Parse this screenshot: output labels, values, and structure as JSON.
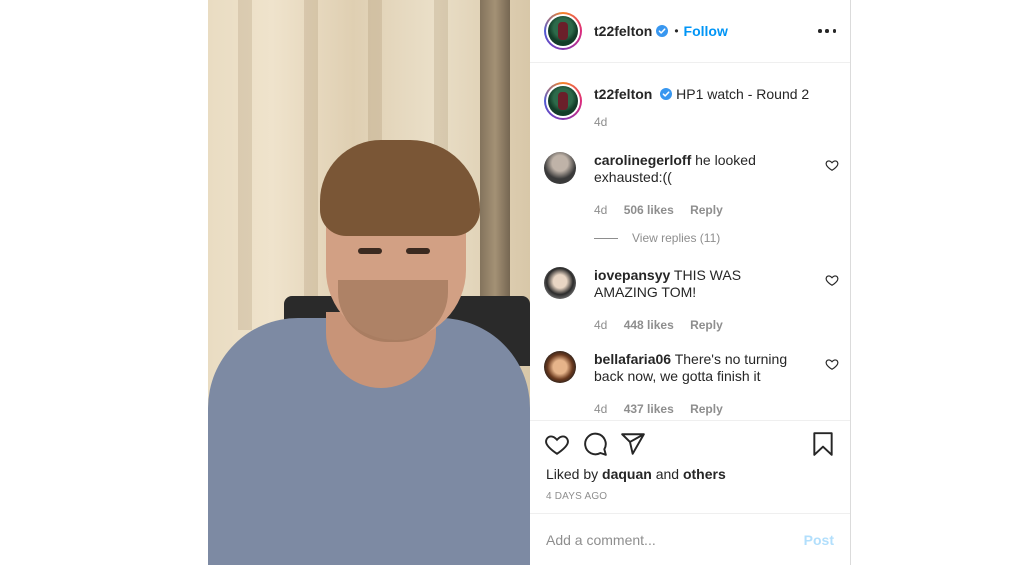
{
  "post": {
    "author": "t22felton",
    "follow_label": "Follow",
    "dot": "•",
    "caption": "HP1 watch - Round 2",
    "caption_time": "4d"
  },
  "comments": [
    {
      "user": "carolinegerloff",
      "text": "he looked exhausted:((",
      "time": "4d",
      "likes": "506 likes",
      "reply": "Reply",
      "avatar_color": "#3a3a3a"
    },
    {
      "user": "iovepansyy",
      "text": "THIS WAS AMAZING TOM!",
      "time": "4d",
      "likes": "448 likes",
      "reply": "Reply",
      "avatar_color": "#4a4a4a"
    },
    {
      "user": "bellafaria06",
      "text": "There's no turning back now, we gotta finish it",
      "time": "4d",
      "likes": "437 likes",
      "reply": "Reply",
      "avatar_color": "#6b3a1f"
    }
  ],
  "view_replies": "View replies (11)",
  "liked_by": {
    "prefix": "Liked by",
    "user": "daquan",
    "and": "and",
    "others": "others"
  },
  "posted_ago": "4 DAYS AGO",
  "add_comment": {
    "placeholder": "Add a comment...",
    "post_label": "Post"
  },
  "colors": {
    "link": "#0095f6",
    "verified": "#3897f0",
    "muted": "#8e8e8e",
    "post_disabled": "#b2dffc"
  },
  "icons": [
    "verified-badge-icon",
    "more-options-icon",
    "heart-icon",
    "comment-icon",
    "share-icon",
    "bookmark-icon"
  ]
}
